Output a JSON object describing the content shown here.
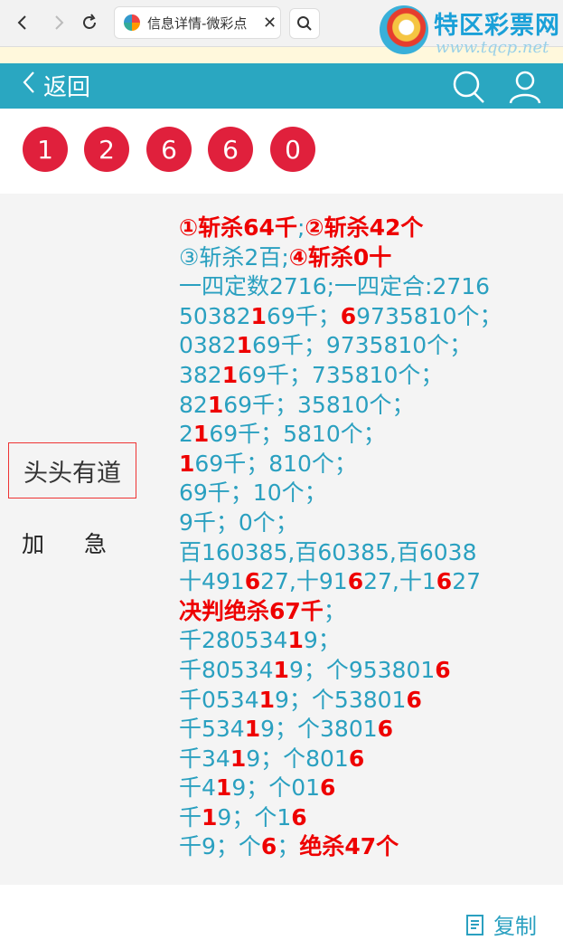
{
  "browser": {
    "tab_title": "信息详情-微彩点",
    "close_glyph": "✕"
  },
  "watermark": {
    "name": "特区彩票网",
    "url": "www.tqcp.net"
  },
  "header": {
    "back_label": "返回"
  },
  "balls": [
    "1",
    "2",
    "6",
    "6",
    "0"
  ],
  "colors": {
    "header_bg": "#2aa7c1",
    "ball": "#e0203c",
    "highlight": "#e00000",
    "text": "#2aa0c0"
  },
  "sidebar": {
    "title": "头头有道",
    "subtitle": "加急"
  },
  "lines": [
    [
      [
        "①斩杀64千",
        true
      ],
      [
        ";",
        false
      ],
      [
        "②斩杀42个",
        true
      ]
    ],
    [
      [
        "③斩杀2百;",
        false
      ],
      [
        "④斩杀0十",
        true
      ]
    ],
    [
      [
        "一四定数2716;一四定合:2716",
        false
      ]
    ],
    [
      [
        "50382",
        false
      ],
      [
        "1",
        true
      ],
      [
        "69千；",
        false
      ],
      [
        "6",
        true
      ],
      [
        "9735810个；",
        false
      ]
    ],
    [
      [
        "0382",
        false
      ],
      [
        "1",
        true
      ],
      [
        "69千；9735810个；",
        false
      ]
    ],
    [
      [
        "382",
        false
      ],
      [
        "1",
        true
      ],
      [
        "69千；735810个；",
        false
      ]
    ],
    [
      [
        "82",
        false
      ],
      [
        "1",
        true
      ],
      [
        "69千；35810个；",
        false
      ]
    ],
    [
      [
        "2",
        false
      ],
      [
        "1",
        true
      ],
      [
        "69千；5810个；",
        false
      ]
    ],
    [
      [
        "1",
        true
      ],
      [
        "69千；810个；",
        false
      ]
    ],
    [
      [
        "69千；10个；",
        false
      ]
    ],
    [
      [
        "9千；0个；",
        false
      ]
    ],
    [
      [
        "百160385,百60385,百6038",
        false
      ]
    ],
    [
      [
        "十491",
        false
      ],
      [
        "6",
        true
      ],
      [
        "27,十91",
        false
      ],
      [
        "6",
        true
      ],
      [
        "27,十1",
        false
      ],
      [
        "6",
        true
      ],
      [
        "27",
        false
      ]
    ],
    [
      [
        "决判绝杀67千",
        true
      ],
      [
        "；",
        false
      ]
    ],
    [
      [
        "千280534",
        false
      ],
      [
        "1",
        true
      ],
      [
        "9；",
        false
      ]
    ],
    [
      [
        "千80534",
        false
      ],
      [
        "1",
        true
      ],
      [
        "9；个953801",
        false
      ],
      [
        "6",
        true
      ]
    ],
    [
      [
        "千0534",
        false
      ],
      [
        "1",
        true
      ],
      [
        "9；个53801",
        false
      ],
      [
        "6",
        true
      ]
    ],
    [
      [
        "千534",
        false
      ],
      [
        "1",
        true
      ],
      [
        "9；个3801",
        false
      ],
      [
        "6",
        true
      ]
    ],
    [
      [
        "千34",
        false
      ],
      [
        "1",
        true
      ],
      [
        "9；个801",
        false
      ],
      [
        "6",
        true
      ]
    ],
    [
      [
        "千4",
        false
      ],
      [
        "1",
        true
      ],
      [
        "9；个01",
        false
      ],
      [
        "6",
        true
      ]
    ],
    [
      [
        "千",
        false
      ],
      [
        "1",
        true
      ],
      [
        "9；个1",
        false
      ],
      [
        "6",
        true
      ]
    ],
    [
      [
        "千9；个",
        false
      ],
      [
        "6",
        true
      ],
      [
        "；",
        false
      ],
      [
        "绝杀47个",
        true
      ]
    ]
  ],
  "footer": {
    "copy_label": "复制"
  }
}
